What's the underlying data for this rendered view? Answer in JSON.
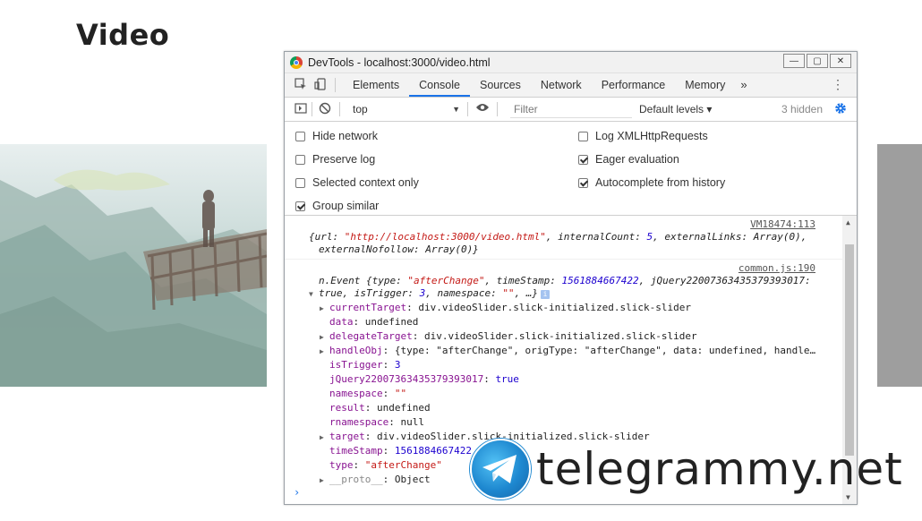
{
  "page": {
    "title": "Video"
  },
  "devtools": {
    "window_title": "DevTools - localhost:3000/video.html",
    "window_buttons": {
      "minimize": "—",
      "restore": "▢",
      "close": "✕"
    },
    "tabs": [
      "Elements",
      "Console",
      "Sources",
      "Network",
      "Performance",
      "Memory"
    ],
    "active_tab": "Console",
    "more_tabs": "»",
    "context": "top",
    "filter_placeholder": "Filter",
    "levels": "Default levels ▾",
    "hidden": "3 hidden",
    "settings": {
      "left": [
        {
          "label": "Hide network",
          "checked": false
        },
        {
          "label": "Preserve log",
          "checked": false
        },
        {
          "label": "Selected context only",
          "checked": false
        },
        {
          "label": "Group similar",
          "checked": true
        }
      ],
      "right": [
        {
          "label": "Log XMLHttpRequests",
          "checked": false
        },
        {
          "label": "Eager evaluation",
          "checked": true
        },
        {
          "label": "Autocomplete from history",
          "checked": true
        }
      ]
    },
    "console": {
      "msg1": {
        "source": "VM18474:113",
        "line1": "{url: \"http://localhost:3000/video.html\", internalCount: 5, externalLinks: Array(0),",
        "line2": "externalNofollow: Array(0)}"
      },
      "msg2": {
        "source": "common.js:190",
        "line1": "n.Event {type: \"afterChange\", timeStamp: 1561884667422, jQuery22007363435379393017:",
        "line2": "true, isTrigger: 3, namespace: \"\", …}",
        "info": "i",
        "props": [
          {
            "expandable": true,
            "key": "currentTarget",
            "value": "div.videoSlider.slick-initialized.slick-slider"
          },
          {
            "expandable": false,
            "key": "data",
            "value": "undefined"
          },
          {
            "expandable": true,
            "key": "delegateTarget",
            "value": "div.videoSlider.slick-initialized.slick-slider"
          },
          {
            "expandable": true,
            "key": "handleObj",
            "value": "{type: \"afterChange\", origType: \"afterChange\", data: undefined, handle…"
          },
          {
            "expandable": false,
            "key": "isTrigger",
            "value": "3"
          },
          {
            "expandable": false,
            "key": "jQuery22007363435379393017",
            "value": "true"
          },
          {
            "expandable": false,
            "key": "namespace",
            "value": "\"\""
          },
          {
            "expandable": false,
            "key": "result",
            "value": "undefined"
          },
          {
            "expandable": false,
            "key": "rnamespace",
            "value": "null"
          },
          {
            "expandable": true,
            "key": "target",
            "value": "div.videoSlider.slick-initialized.slick-slider"
          },
          {
            "expandable": false,
            "key": "timeStamp",
            "value": "1561884667422"
          },
          {
            "expandable": false,
            "key": "type",
            "value": "\"afterChange\""
          },
          {
            "expandable": true,
            "key": "__proto__",
            "value": "Object"
          }
        ]
      },
      "prompt": "›"
    }
  },
  "watermark": {
    "text": "telegrammy.net"
  },
  "icons": {
    "inspect": "inspect-icon",
    "device": "device-toggle-icon",
    "sidebar": "console-sidebar-icon",
    "clear": "clear-console-icon",
    "eye": "live-expression-icon",
    "gear": "settings-gear-icon",
    "kebab": "more-options-icon"
  },
  "colors": {
    "accent": "#1a73e8",
    "string": "#c41a16",
    "number": "#1c00cf",
    "key": "#881391"
  }
}
